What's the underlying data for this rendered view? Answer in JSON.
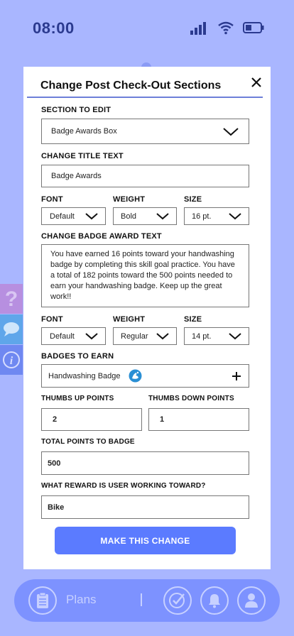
{
  "status_bar": {
    "time": "08:00",
    "icons": [
      "signal-icon",
      "wifi-icon",
      "battery-icon"
    ]
  },
  "side_tabs": [
    {
      "name": "help",
      "glyph": "?"
    },
    {
      "name": "chat",
      "glyph": ""
    },
    {
      "name": "info",
      "glyph": "i"
    }
  ],
  "modal": {
    "title": "Change Post Check-Out Sections",
    "section_label": "SECTION TO EDIT",
    "section_value": "Badge Awards Box",
    "title_text_label": "CHANGE TITLE TEXT",
    "title_text_value": "Badge Awards",
    "font_label": "FONT",
    "weight_label": "WEIGHT",
    "size_label": "SIZE",
    "title_font": "Default",
    "title_weight": "Bold",
    "title_size": "16 pt.",
    "badge_text_label": "CHANGE BADGE AWARD TEXT",
    "badge_text_value": "You have earned 16 points toward your handwashing badge by completing this skill goal practice. You have a total of 182 points toward the 500 points needed to earn your handwashing badge. Keep up the great work!!",
    "body_font": "Default",
    "body_weight": "Regular",
    "body_size": "14 pt.",
    "badges_label": "BADGES TO EARN",
    "badge_value": "Handwashing Badge",
    "thumbs_up_label": "THUMBS UP POINTS",
    "thumbs_up_value": "2",
    "thumbs_down_label": "THUMBS DOWN POINTS",
    "thumbs_down_value": "1",
    "total_label": "TOTAL POINTS TO BADGE",
    "total_value": "500",
    "reward_label": "WHAT REWARD IS USER WORKING TOWARD?",
    "reward_value": "Bike",
    "cta_label": "MAKE THIS CHANGE"
  },
  "bottom_nav": {
    "plans_label": "Plans",
    "divider": "|"
  },
  "colors": {
    "background": "#a9b6ff",
    "accent": "#5b7bff",
    "nav": "#7d92ff",
    "title_rule": "#6d7fd8"
  }
}
